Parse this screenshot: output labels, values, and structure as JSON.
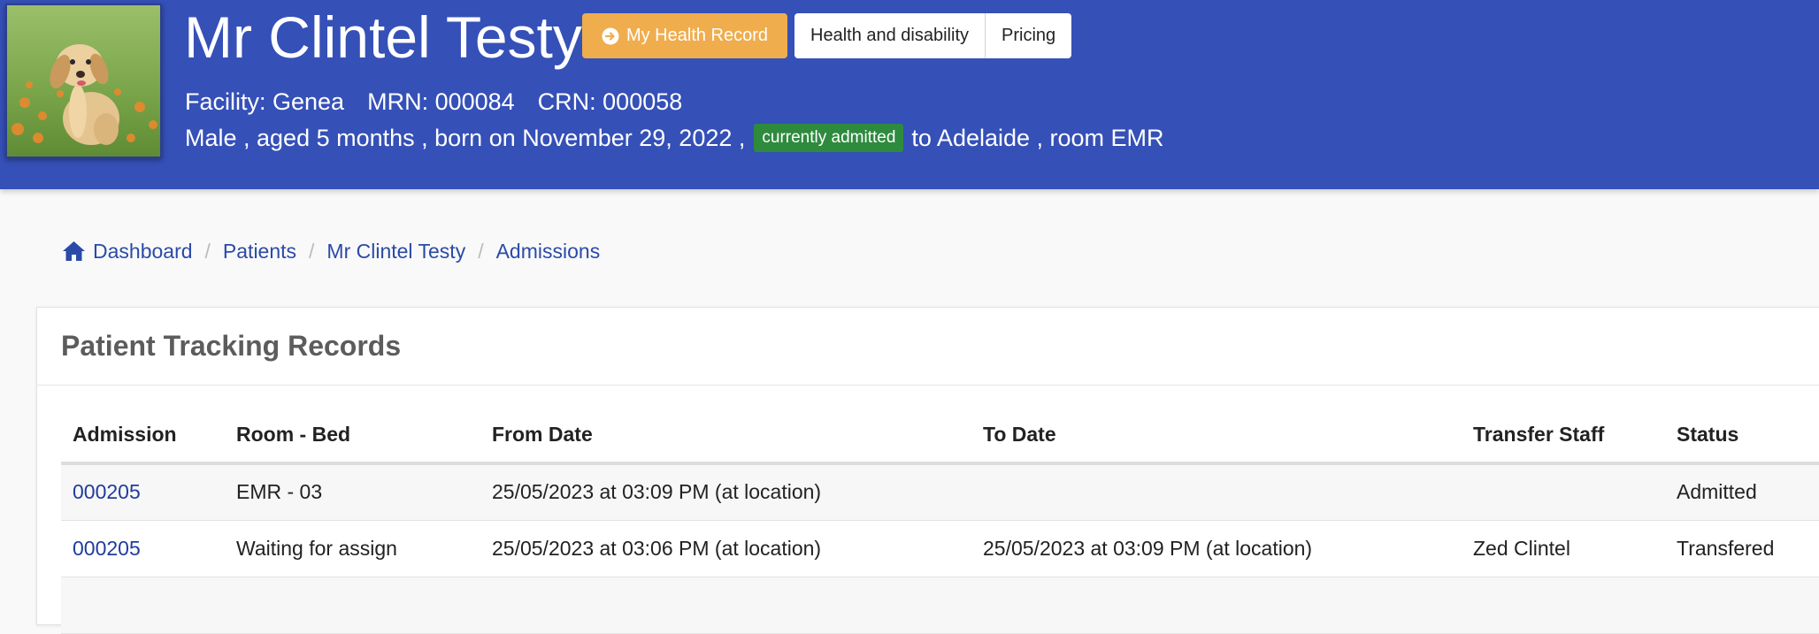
{
  "patient": {
    "name": "Mr Clintel Testy",
    "facility_text": "Facility: Genea",
    "mrn_text": "MRN: 000084",
    "crn_text": "CRN: 000058",
    "demographics_text": "Male , aged 5 months , born on November 29, 2022 ,",
    "admitted_badge": "currently admitted",
    "location_text": "to Adelaide , room EMR"
  },
  "header_buttons": {
    "my_health_record": "My Health Record",
    "health_and_disability": "Health and disability",
    "pricing": "Pricing"
  },
  "breadcrumb": {
    "dashboard": "Dashboard",
    "patients": "Patients",
    "patient": "Mr Clintel Testy",
    "admissions": "Admissions"
  },
  "panel": {
    "title": "Patient Tracking Records"
  },
  "table": {
    "headers": {
      "admission": "Admission",
      "room_bed": "Room - Bed",
      "from_date": "From Date",
      "to_date": "To Date",
      "transfer_staff": "Transfer Staff",
      "status": "Status"
    },
    "rows": [
      {
        "admission": "000205",
        "room_bed": "EMR - 03",
        "from_date": "25/05/2023 at 03:09 PM (at location)",
        "to_date": "",
        "transfer_staff": "",
        "status": "Admitted"
      },
      {
        "admission": "000205",
        "room_bed": "Waiting for assign",
        "from_date": "25/05/2023 at 03:06 PM (at location)",
        "to_date": "25/05/2023 at 03:09 PM (at location)",
        "transfer_staff": "Zed Clintel",
        "status": "Transfered"
      }
    ]
  },
  "colors": {
    "header_bg": "#3550b7",
    "health_record_button": "#f0ad4e",
    "admitted_badge": "#2e8b3e",
    "link": "#2b4aa8"
  },
  "icons": {
    "health_record_button": "arrow-circle-right-icon",
    "breadcrumb_home": "home-icon"
  }
}
